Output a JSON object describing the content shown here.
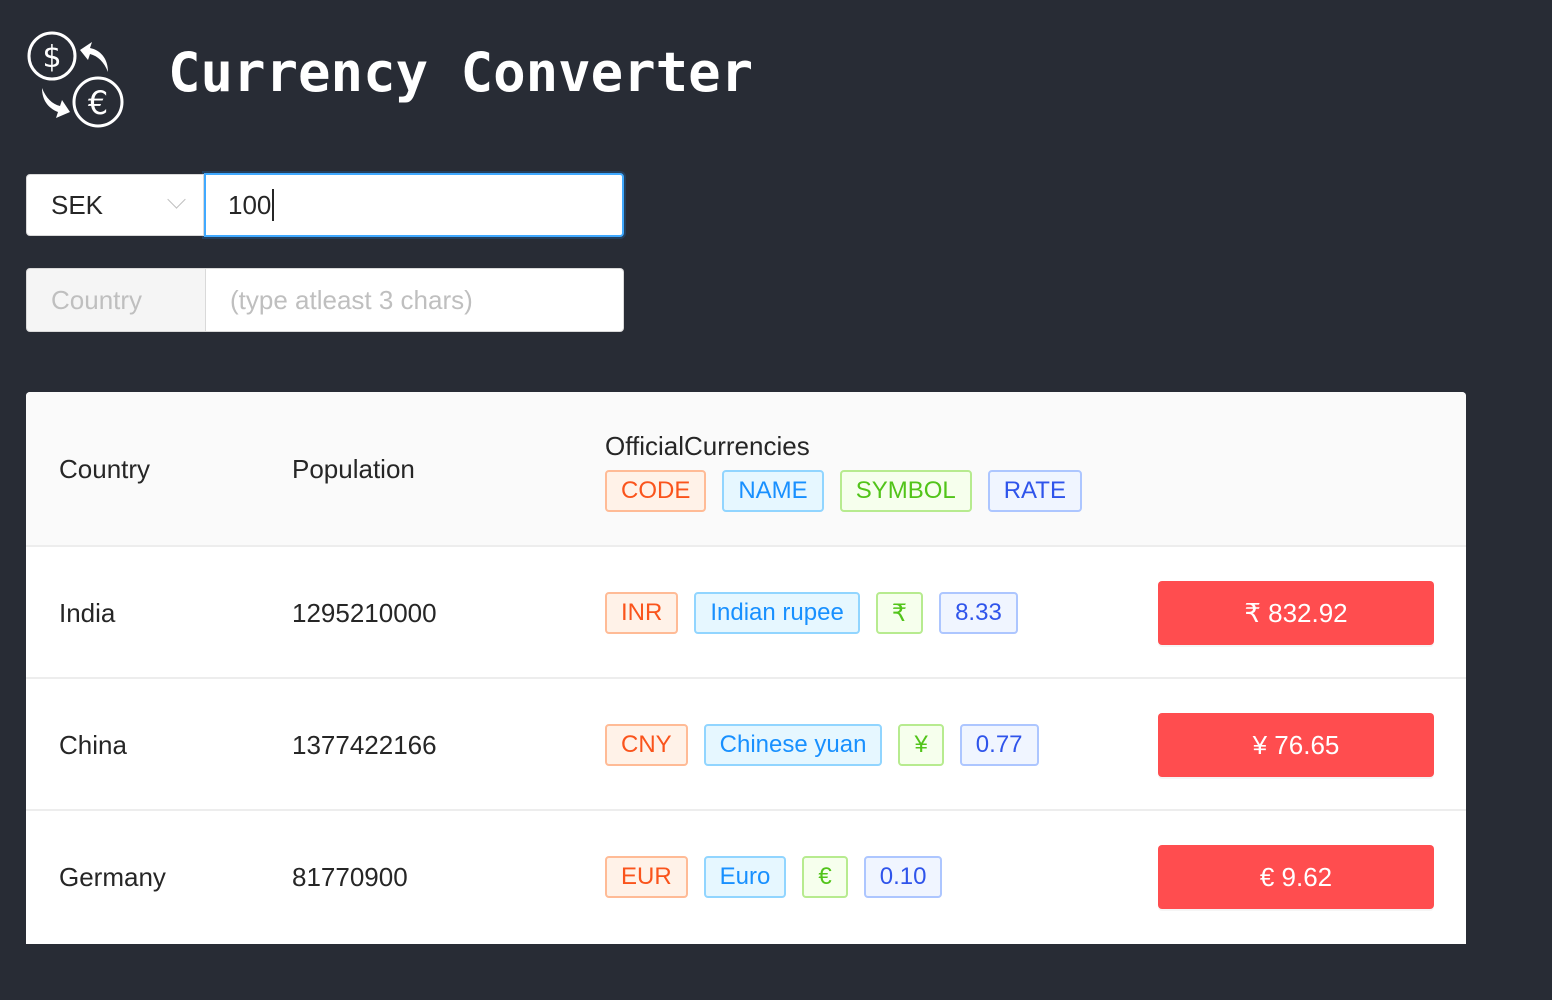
{
  "header": {
    "title": "Currency Converter",
    "logo_icon": "currency-exchange-icon"
  },
  "converter": {
    "base_currency": "SEK",
    "amount": "100"
  },
  "search": {
    "addon_label": "Country",
    "placeholder": "(type atleast 3 chars)",
    "value": ""
  },
  "table": {
    "columns": {
      "country": "Country",
      "population": "Population",
      "currencies": "OfficialCurrencies"
    },
    "currency_legend": {
      "code": "CODE",
      "name": "NAME",
      "symbol": "SYMBOL",
      "rate": "RATE"
    },
    "rows": [
      {
        "country": "India",
        "population": "1295210000",
        "code": "INR",
        "name": "Indian rupee",
        "symbol": "₹",
        "rate": "8.33",
        "converted": "₹ 832.92"
      },
      {
        "country": "China",
        "population": "1377422166",
        "code": "CNY",
        "name": "Chinese yuan",
        "symbol": "¥",
        "rate": "0.77",
        "converted": "¥ 76.65"
      },
      {
        "country": "Germany",
        "population": "81770900",
        "code": "EUR",
        "name": "Euro",
        "symbol": "€",
        "rate": "0.10",
        "converted": "€ 9.62"
      }
    ]
  },
  "colors": {
    "background": "#282c35",
    "code": "#fa541c",
    "name": "#1890ff",
    "symbol": "#52c41a",
    "rate": "#2f54eb",
    "converted_button": "#ff4d4f",
    "focus": "#40a9ff"
  }
}
